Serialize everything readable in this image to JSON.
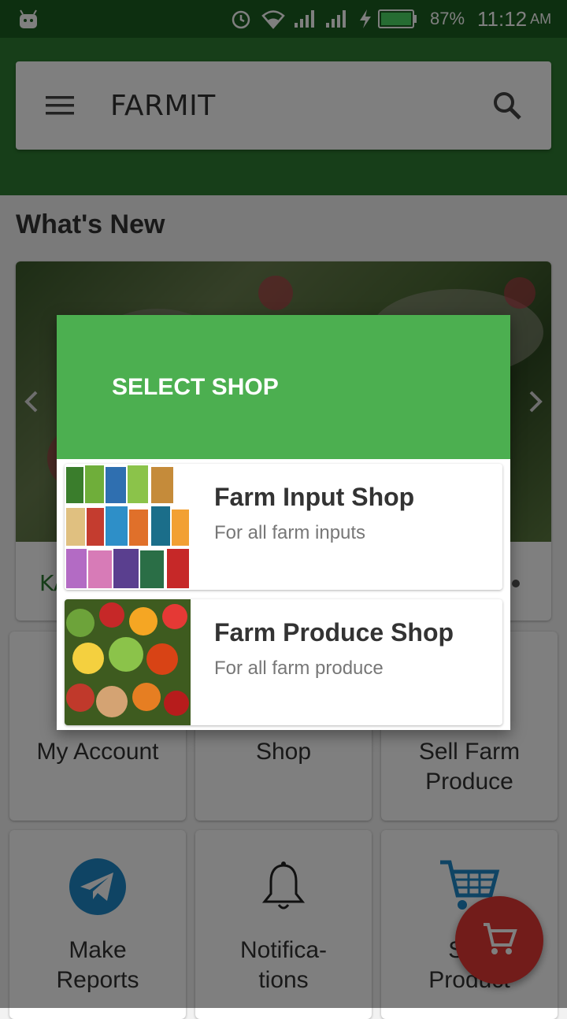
{
  "status_bar": {
    "battery": "87%",
    "time": "11:12",
    "ampm": "AM",
    "icons": [
      "android-icon",
      "alarm-icon",
      "wifi-icon",
      "signal-icon",
      "signal-icon",
      "charging-icon",
      "battery-icon"
    ]
  },
  "toolbar": {
    "title": "FARMIT",
    "menu_icon": "menu-icon",
    "search_icon": "search-icon"
  },
  "whats_new": {
    "title": "What's New",
    "caption": "KA"
  },
  "tiles": [
    {
      "label": "My Account"
    },
    {
      "label": "Shop"
    },
    {
      "label": "Sell Farm Produce"
    },
    {
      "label": "Make Reports",
      "icon": "telegram-icon"
    },
    {
      "label": "Notifica- tions",
      "icon": "bell-icon"
    },
    {
      "label": "Sug Product",
      "icon": "shopping-cart-icon"
    }
  ],
  "dialog": {
    "title": "SELECT SHOP",
    "shops": [
      {
        "name": "Farm Input Shop",
        "desc": "For all farm inputs"
      },
      {
        "name": "Farm Produce Shop",
        "desc": "For all farm produce"
      }
    ]
  },
  "fab": {
    "icon": "cart-icon"
  },
  "colors": {
    "status_bar": "#1b5e20",
    "app_bar": "#2e7d32",
    "dialog_header": "#4caf50",
    "fab": "#e53935",
    "telegram": "#1e88c9"
  }
}
